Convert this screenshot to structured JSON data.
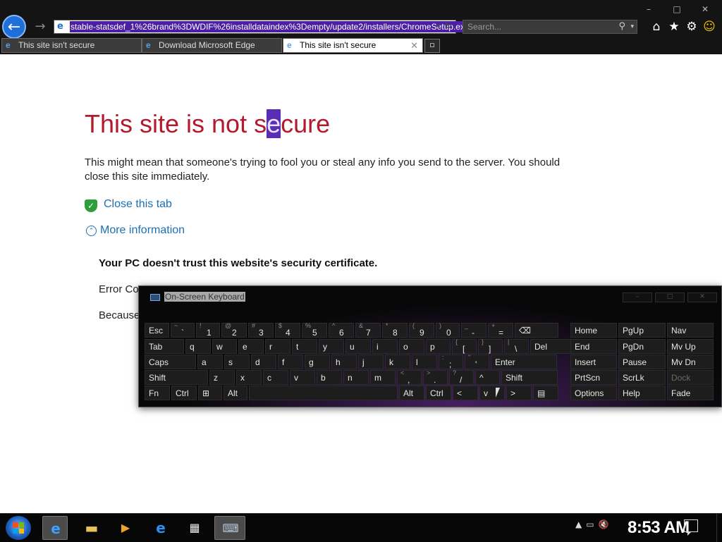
{
  "browser": {
    "address_url": "stable-statsdef_1%26brand%3DWDIF%26installdataindex%3Dempty/update2/installers/ChromeSetup.exe",
    "search_placeholder": "Search...",
    "tabs": [
      {
        "label": "This site isn't secure",
        "active": false
      },
      {
        "label": "Download Microsoft Edge",
        "active": false
      },
      {
        "label": "This site isn't secure",
        "active": true
      }
    ],
    "window_controls": [
      "–",
      "□",
      "✕"
    ]
  },
  "page": {
    "title_part1": "This site is not s",
    "title_selected": "e",
    "title_part2": "cure",
    "description": "This might mean that someone's trying to fool you or steal any info you send to the server. You should close this site immediately.",
    "close_tab_label": "Close this tab",
    "more_info_label": "More information",
    "trust_heading": "Your PC doesn't trust this website's security certificate.",
    "error_code_partial": "Error Co",
    "because_partial": "Because"
  },
  "osk": {
    "title": "On-Screen Keyboard",
    "rows": [
      [
        {
          "l": "Esc"
        },
        {
          "s": "~",
          "m": "`"
        },
        {
          "s": "!",
          "m": "1"
        },
        {
          "s": "@",
          "m": "2"
        },
        {
          "s": "#",
          "m": "3"
        },
        {
          "s": "$",
          "m": "4"
        },
        {
          "s": "%",
          "m": "5"
        },
        {
          "s": "^",
          "m": "6"
        },
        {
          "s": "&",
          "m": "7"
        },
        {
          "s": "*",
          "m": "8"
        },
        {
          "s": "(",
          "m": "9"
        },
        {
          "s": ")",
          "m": "0"
        },
        {
          "s": "_",
          "m": "-"
        },
        {
          "s": "+",
          "m": "="
        },
        {
          "l": "⌫"
        }
      ],
      [
        {
          "l": "Tab"
        },
        {
          "l": "q"
        },
        {
          "l": "w"
        },
        {
          "l": "e"
        },
        {
          "l": "r"
        },
        {
          "l": "t"
        },
        {
          "l": "y"
        },
        {
          "l": "u"
        },
        {
          "l": "i"
        },
        {
          "l": "o"
        },
        {
          "l": "p"
        },
        {
          "s": "{",
          "m": "["
        },
        {
          "s": "}",
          "m": "]"
        },
        {
          "s": "|",
          "m": "\\"
        },
        {
          "l": "Del"
        }
      ],
      [
        {
          "l": "Caps"
        },
        {
          "l": "a"
        },
        {
          "l": "s"
        },
        {
          "l": "d"
        },
        {
          "l": "f"
        },
        {
          "l": "g"
        },
        {
          "l": "h"
        },
        {
          "l": "j"
        },
        {
          "l": "k"
        },
        {
          "l": "l"
        },
        {
          "s": ":",
          "m": ";"
        },
        {
          "s": "\"",
          "m": "'"
        },
        {
          "l": "Enter"
        }
      ],
      [
        {
          "l": "Shift"
        },
        {
          "l": "z"
        },
        {
          "l": "x"
        },
        {
          "l": "c"
        },
        {
          "l": "v"
        },
        {
          "l": "b"
        },
        {
          "l": "n"
        },
        {
          "l": "m"
        },
        {
          "s": "<",
          "m": ","
        },
        {
          "s": ">",
          "m": "."
        },
        {
          "s": "?",
          "m": "/"
        },
        {
          "l": "^"
        },
        {
          "l": "Shift"
        }
      ],
      [
        {
          "l": "Fn"
        },
        {
          "l": "Ctrl"
        },
        {
          "l": "⊞"
        },
        {
          "l": "Alt"
        },
        {
          "l": ""
        },
        {
          "l": "Alt"
        },
        {
          "l": "Ctrl"
        },
        {
          "l": "<"
        },
        {
          "l": "v"
        },
        {
          "l": ">"
        },
        {
          "l": "▤"
        }
      ]
    ],
    "nav": [
      [
        "Home",
        "PgUp",
        "Nav"
      ],
      [
        "End",
        "PgDn",
        "Mv Up"
      ],
      [
        "Insert",
        "Pause",
        "Mv Dn"
      ],
      [
        "PrtScn",
        "ScrLk",
        "Dock"
      ],
      [
        "Options",
        "Help",
        "Fade"
      ]
    ]
  },
  "taskbar": {
    "clock": "8:53 AM",
    "icons": [
      "ie-icon",
      "file-explorer-icon",
      "media-player-icon",
      "edge-icon",
      "store-icon",
      "on-screen-keyboard-icon"
    ]
  }
}
